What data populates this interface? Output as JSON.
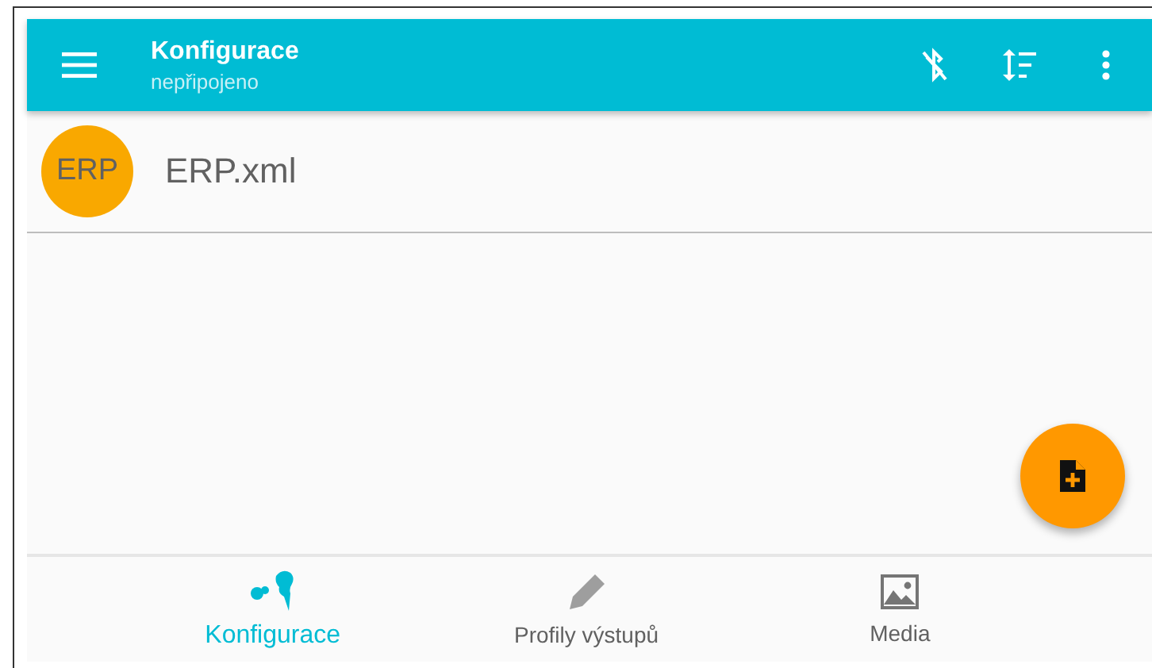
{
  "toolbar": {
    "title": "Konfigurace",
    "subtitle": "nepřipojeno"
  },
  "files": [
    {
      "avatar": "ERP",
      "name": "ERP.xml"
    }
  ],
  "bottom_nav": [
    {
      "label": "Konfigurace",
      "kind": "config",
      "selected": true
    },
    {
      "label": "Profily výstupů",
      "kind": "pencil",
      "selected": false
    },
    {
      "label": "Media",
      "kind": "image",
      "selected": false
    }
  ]
}
